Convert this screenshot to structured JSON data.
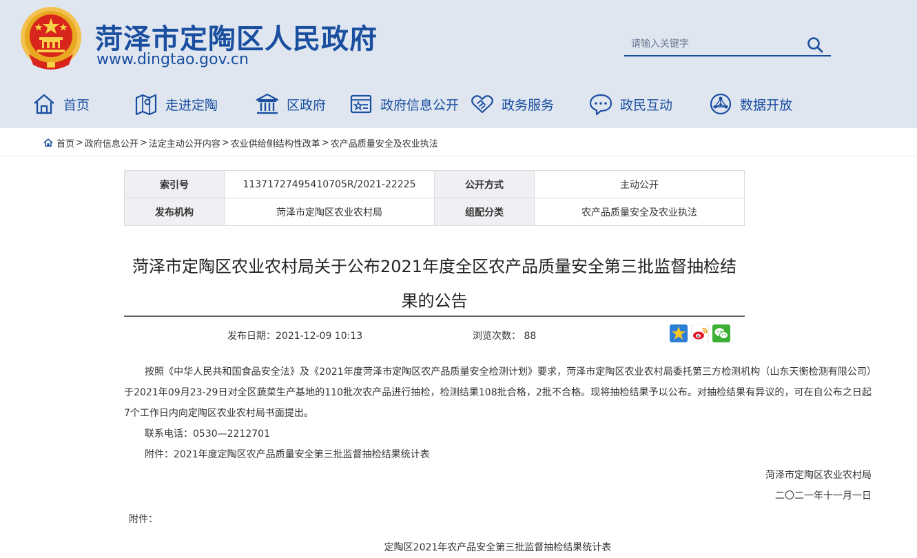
{
  "header": {
    "site_title": "菏泽市定陶区人民政府",
    "site_url": "www.dingtao.gov.cn",
    "brand_color": "#1a4fa0",
    "header_bg": "#dfe6f0"
  },
  "search": {
    "placeholder": "请输入关键字",
    "value": ""
  },
  "nav": {
    "items": [
      {
        "label": "首页",
        "icon": "home-icon"
      },
      {
        "label": "走进定陶",
        "icon": "map-icon"
      },
      {
        "label": "区政府",
        "icon": "government-building-icon"
      },
      {
        "label": "政府信息公开",
        "icon": "info-board-icon"
      },
      {
        "label": "政务服务",
        "icon": "handshake-icon"
      },
      {
        "label": "政民互动",
        "icon": "chat-bubble-icon"
      },
      {
        "label": "数据开放",
        "icon": "network-globe-icon"
      }
    ]
  },
  "breadcrumb": {
    "items": [
      "首页",
      "政府信息公开",
      "法定主动公开内容",
      "农业供给侧结构性改革",
      "农产品质量安全及农业执法"
    ],
    "separator": ">"
  },
  "meta": {
    "index_label": "索引号",
    "index_value": "11371727495410705R/2021-22225",
    "disclosure_label": "公开方式",
    "disclosure_value": "主动公开",
    "publisher_label": "发布机构",
    "publisher_value": "菏泽市定陶区农业农村局",
    "category_label": "组配分类",
    "category_value": "农产品质量安全及农业执法"
  },
  "article": {
    "title": "菏泽市定陶区农业农村局关于公布2021年度全区农产品质量安全第三批监督抽检结果的公告",
    "date_text": "发布日期：2021-12-09 10:13",
    "views_text": "浏览次数：  88",
    "paragraph_1": "按照《中华人民共和国食品安全法》及《2021年度菏泽市定陶区农产品质量安全检测计划》要求，菏泽市定陶区农业农村局委托第三方检测机构（山东天衡检测有限公司）于2021年09月23-29日对全区蔬菜生产基地的110批次农产品进行抽检，检测结果108批合格，2批不合格。现将抽检结果予以公布。对抽检结果有异议的，可在自公布之日起7个工作日内向定陶区农业农村局书面提出。",
    "contact": "联系电话：0530—2212701",
    "attachment_line": "附件：2021年度定陶区农产品质量安全第三批监督抽检结果统计表",
    "signature_org": "菏泽市定陶区农业农村局",
    "signature_date": "二〇二一年十一月一日",
    "attach_label": "附件：",
    "attach_table_title": "定陶区2021年农产品安全第三批监督抽检结果统计表"
  },
  "share": {
    "icons": [
      "qzone-star-icon",
      "weibo-icon",
      "wechat-icon"
    ]
  }
}
